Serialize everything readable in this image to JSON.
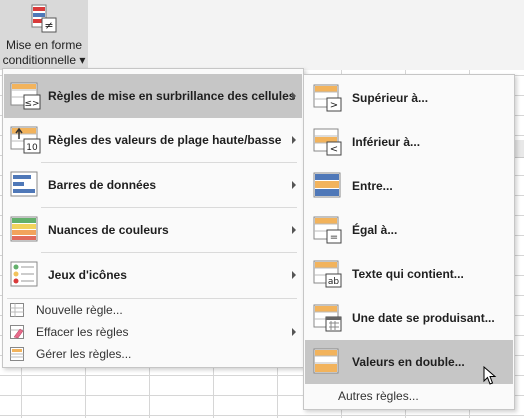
{
  "ribbon": {
    "button_line1": "Mise en forme",
    "button_line2": "conditionnelle ▾"
  },
  "main_menu": {
    "items": [
      {
        "label": "Règles de mise en surbrillance des cellules",
        "icon": "highlight-rules-icon",
        "has_submenu": true,
        "highlighted": true
      },
      {
        "label": "Règles des valeurs de plage haute/basse",
        "icon": "top-bottom-rules-icon",
        "has_submenu": true
      },
      {
        "label": "Barres de données",
        "icon": "data-bars-icon",
        "has_submenu": true
      },
      {
        "label": "Nuances de couleurs",
        "icon": "color-scales-icon",
        "has_submenu": true
      },
      {
        "label": "Jeux d'icônes",
        "icon": "icon-sets-icon",
        "has_submenu": true
      }
    ],
    "small_items": [
      {
        "label": "Nouvelle règle...",
        "icon": "new-rule-icon"
      },
      {
        "label": "Effacer les règles",
        "icon": "clear-rules-icon",
        "has_submenu": true
      },
      {
        "label": "Gérer les règles...",
        "icon": "manage-rules-icon"
      }
    ]
  },
  "sub_menu": {
    "items": [
      {
        "label": "Supérieur à...",
        "icon": "greater-than-icon"
      },
      {
        "label": "Inférieur à...",
        "icon": "less-than-icon"
      },
      {
        "label": "Entre...",
        "icon": "between-icon"
      },
      {
        "label": "Égal à...",
        "icon": "equal-to-icon"
      },
      {
        "label": "Texte qui contient...",
        "icon": "text-contains-icon"
      },
      {
        "label": "Une date se produisant...",
        "icon": "date-occurring-icon"
      },
      {
        "label": "Valeurs en double...",
        "icon": "duplicate-values-icon",
        "highlighted": true
      }
    ],
    "more_rules": "Autres règles..."
  },
  "colors": {
    "highlight": "#c6c6c6",
    "menu_bg": "#fafafa",
    "accent_orange": "#f2b35c",
    "accent_blue": "#4f78b8"
  }
}
